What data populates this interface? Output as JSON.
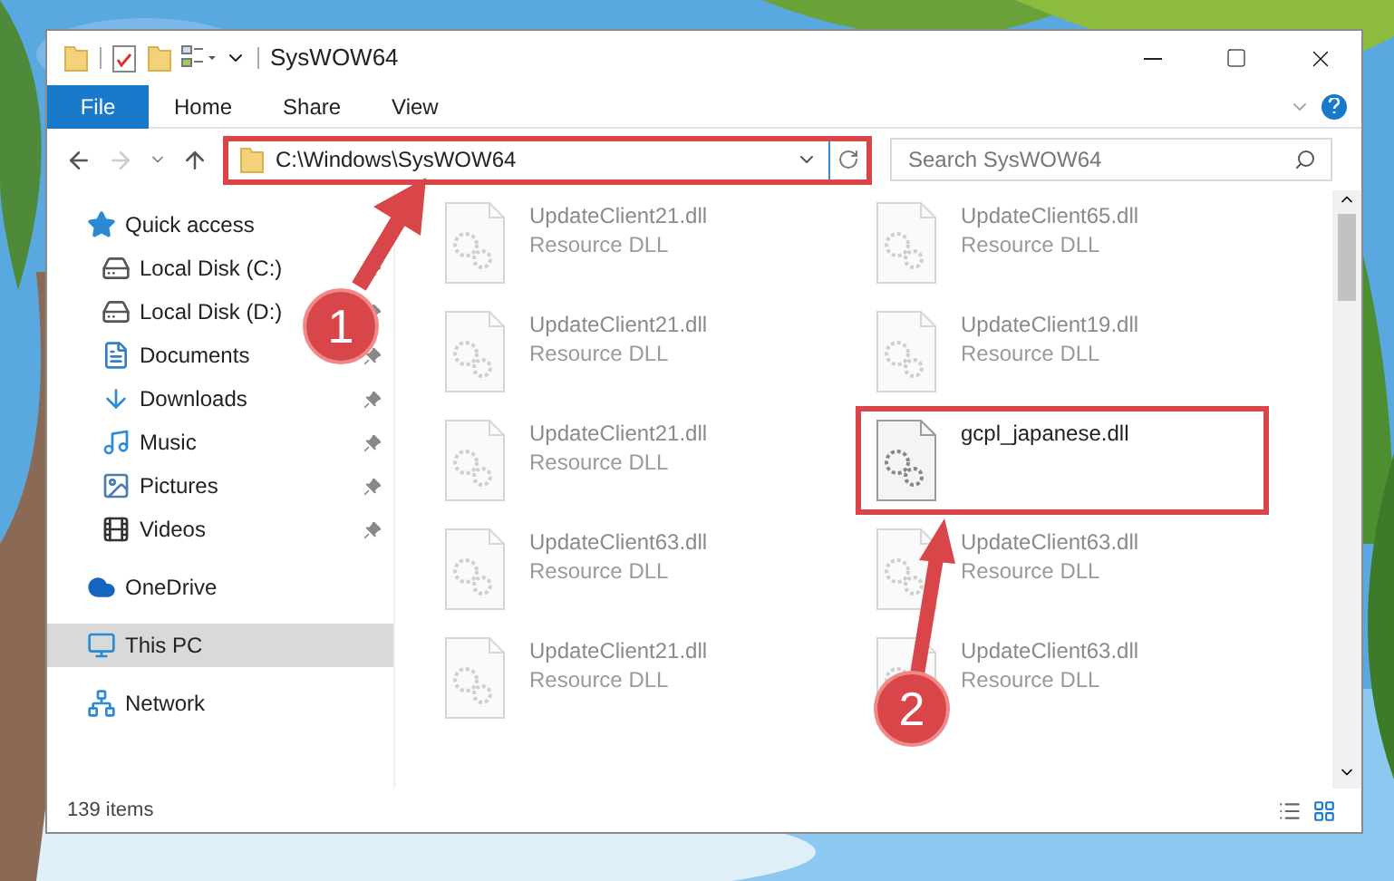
{
  "window": {
    "title": "SysWOW64"
  },
  "ribbon_tabs": [
    {
      "label": "File",
      "selected": true
    },
    {
      "label": "Home",
      "selected": false
    },
    {
      "label": "Share",
      "selected": false
    },
    {
      "label": "View",
      "selected": false
    }
  ],
  "address": {
    "path": "C:\\Windows\\SysWOW64",
    "highlighted": true
  },
  "search": {
    "placeholder": "Search SysWOW64"
  },
  "sidebar": [
    {
      "label": "Quick access",
      "kind": "star",
      "selected": false,
      "children": [
        {
          "label": "Local Disk (C:)",
          "kind": "disk-c",
          "pinned": true,
          "selected": false
        },
        {
          "label": "Local Disk (D:)",
          "kind": "disk",
          "pinned": true,
          "selected": false
        },
        {
          "label": "Documents",
          "kind": "documents",
          "pinned": true,
          "selected": false
        },
        {
          "label": "Downloads",
          "kind": "downloads",
          "pinned": true,
          "selected": false
        },
        {
          "label": "Music",
          "kind": "music",
          "pinned": true,
          "selected": false
        },
        {
          "label": "Pictures",
          "kind": "pictures",
          "pinned": true,
          "selected": false
        },
        {
          "label": "Videos",
          "kind": "videos",
          "pinned": true,
          "selected": false
        }
      ]
    },
    {
      "label": "OneDrive",
      "kind": "cloud",
      "selected": false
    },
    {
      "label": "This PC",
      "kind": "pc",
      "selected": true
    },
    {
      "label": "Network",
      "kind": "network",
      "selected": false
    }
  ],
  "files": [
    {
      "name": "UpdateClient21.dll",
      "type": "Resource DLL",
      "highlighted": false
    },
    {
      "name": "UpdateClient65.dll",
      "type": "Resource DLL",
      "highlighted": false
    },
    {
      "name": "UpdateClient21.dll",
      "type": "Resource DLL",
      "highlighted": false
    },
    {
      "name": "UpdateClient19.dll",
      "type": "Resource DLL",
      "highlighted": false
    },
    {
      "name": "UpdateClient21.dll",
      "type": "Resource DLL",
      "highlighted": false
    },
    {
      "name": "gcpl_japanese.dll",
      "highlighted": true
    },
    {
      "name": "UpdateClient63.dll",
      "type": "Resource DLL",
      "highlighted": false
    },
    {
      "name": "UpdateClient63.dll",
      "type": "Resource DLL",
      "highlighted": false
    },
    {
      "name": "UpdateClient21.dll",
      "type": "Resource DLL",
      "highlighted": false
    },
    {
      "name": "UpdateClient63.dll",
      "type": "Resource DLL",
      "highlighted": false
    }
  ],
  "status_bar": {
    "count": "139 items"
  },
  "annotations": [
    {
      "number": "1"
    },
    {
      "number": "2"
    }
  ]
}
